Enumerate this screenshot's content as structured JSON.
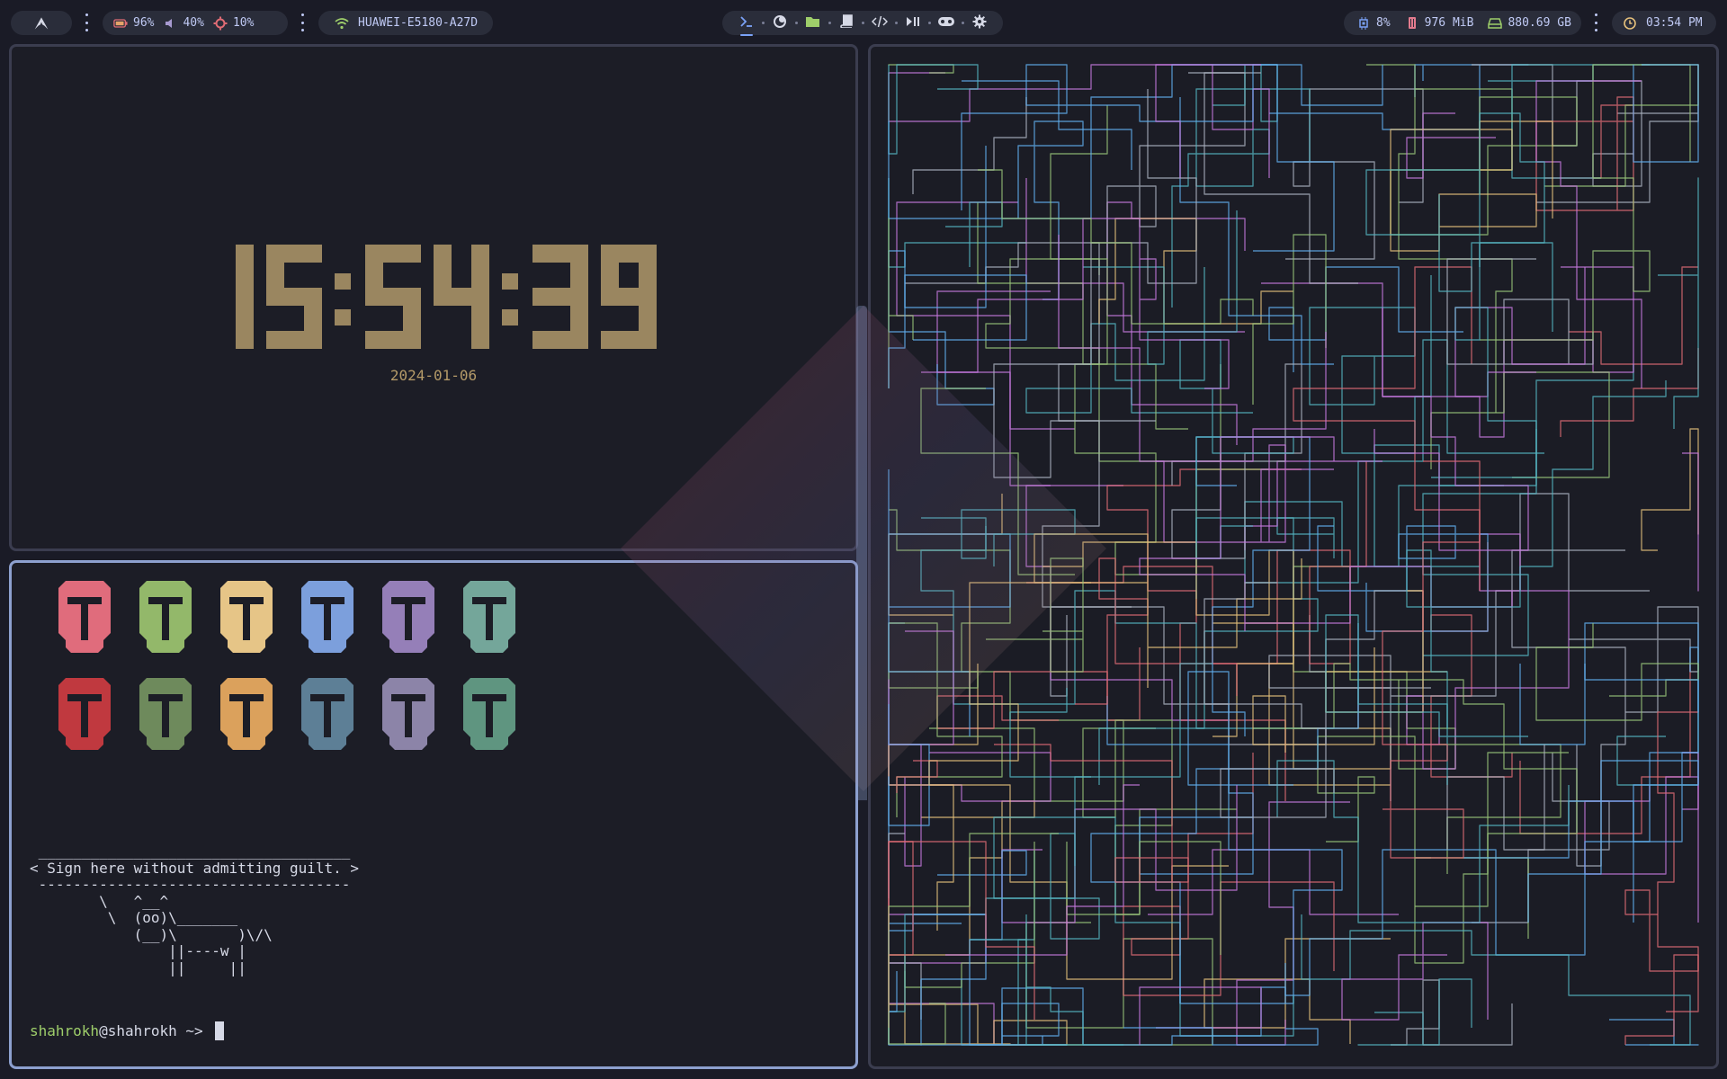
{
  "topbar": {
    "logo_icon": "arch-linux-logo-icon",
    "battery": {
      "icon": "battery-icon",
      "value": "96%"
    },
    "volume": {
      "icon": "speaker-icon",
      "value": "40%"
    },
    "brightness": {
      "icon": "brightness-icon",
      "value": "10%"
    },
    "network": {
      "icon": "wifi-icon",
      "ssid": "HUAWEI-E5180-A27D"
    },
    "workspaces": [
      {
        "icon": "terminal-icon",
        "active": true
      },
      {
        "icon": "firefox-icon"
      },
      {
        "icon": "folder-icon"
      },
      {
        "icon": "book-icon"
      },
      {
        "icon": "code-icon"
      },
      {
        "icon": "play-pause-icon"
      },
      {
        "icon": "gamepad-icon"
      },
      {
        "icon": "settings-icon"
      }
    ],
    "cpu": {
      "icon": "cpu-icon",
      "value": "8%"
    },
    "memory": {
      "icon": "memory-icon",
      "value": "976 MiB"
    },
    "disk": {
      "icon": "disk-icon",
      "value": "880.69 GB"
    },
    "clock": {
      "icon": "clock-icon",
      "value": "03:54 PM"
    }
  },
  "clock_window": {
    "time": "15:54:39",
    "date": "2024-01-06",
    "time_color": "#9a8660"
  },
  "terminal": {
    "helmet_colors_row1": [
      "#e06c7c",
      "#93b86a",
      "#e6c587",
      "#7c9fdc",
      "#957fb8",
      "#74a69a"
    ],
    "helmet_colors_row2": [
      "#c0393f",
      "#6e8a5c",
      "#dba15c",
      "#5d7f96",
      "#8c84a8",
      "#5f9580"
    ],
    "cowsay": " ____________________________________\n< Sign here without admitting guilt. >\n ------------------------------------\n        \\   ^__^\n         \\  (oo)\\_______\n            (__)\\       )\\/\\\n                ||----w |\n                ||     ||",
    "prompt_user": "shahrokh",
    "prompt_rest": "@shahrokh ~> "
  },
  "pipes": {
    "colors": [
      "#e06c75",
      "#98c379",
      "#e5c07b",
      "#61afef",
      "#c678dd",
      "#56b6c2",
      "#abb2bf"
    ]
  }
}
